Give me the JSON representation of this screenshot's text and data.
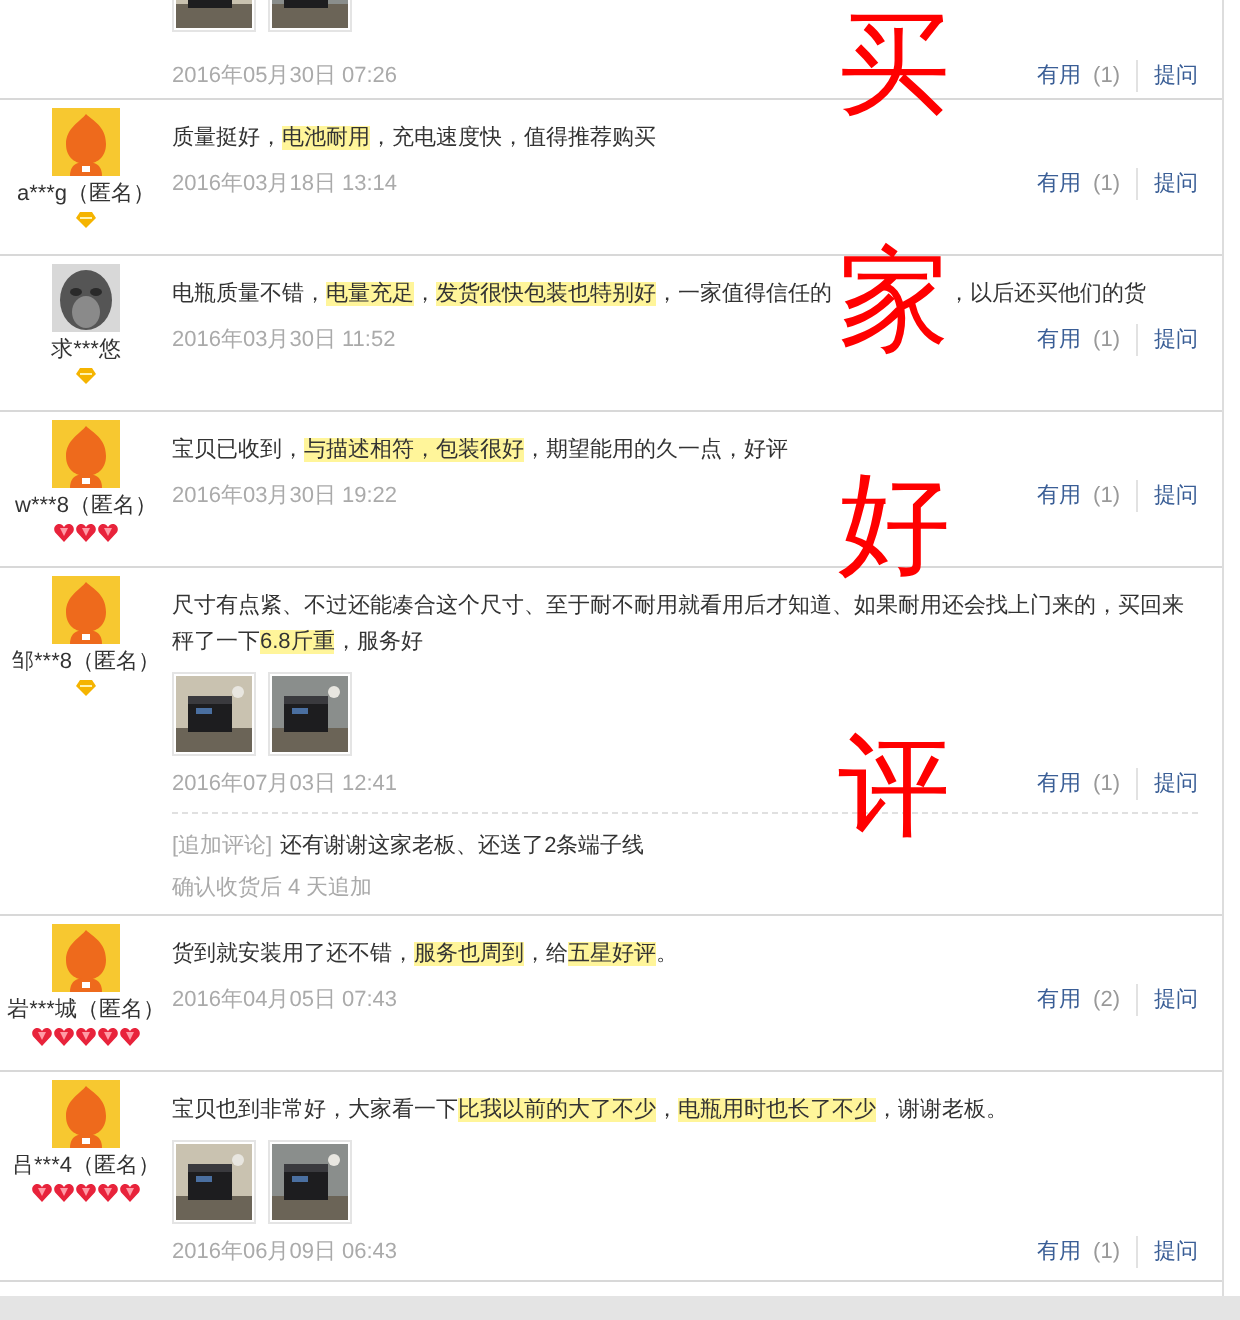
{
  "overlay": {
    "characters": [
      "买",
      "家",
      "好",
      "评"
    ]
  },
  "reviews": [
    {
      "date": "2016年05月30日 07:26",
      "useful_label": "有用",
      "useful_count": "(1)",
      "ask_label": "提问"
    },
    {
      "user": {
        "name": "a***g（匿名）",
        "avatar": {
          "kind": "mascot"
        },
        "rank": {
          "kind": "diamond"
        }
      },
      "text": "质量挺好，**电池耐用**，充电速度快，值得推荐购买",
      "date": "2016年03月18日 13:14",
      "useful_label": "有用",
      "useful_count": "(1)",
      "ask_label": "提问"
    },
    {
      "user": {
        "name": "求***悠",
        "rank": {
          "kind": "diamond"
        }
      },
      "text": "电瓶质量不错，**电量充足**，**发货很快包装也特别好**，一家值得信任的",
      "text_after_overlay": "，以后还买他们的货",
      "date": "2016年03月30日 11:52",
      "useful_label": "有用",
      "useful_count": "(1)",
      "ask_label": "提问"
    },
    {
      "user": {
        "name": "w***8（匿名）",
        "avatar": {
          "kind": "mascot"
        },
        "rank": {
          "kind": "heart",
          "stars": 3
        }
      },
      "text": "宝贝已收到，**与描述相符，包装很好**，期望能用的久一点，好评",
      "date": "2016年03月30日 19:22",
      "useful_label": "有用",
      "useful_count": "(1)",
      "ask_label": "提问"
    },
    {
      "user": {
        "name": "邹***8（匿名）",
        "avatar": {
          "kind": "mascot"
        },
        "rank": {
          "kind": "diamond"
        }
      },
      "text": "尺寸有点紧、不过还能凑合这个尺寸、至于耐不耐用就看用后才知道、如果耐用还会找上门来的，买回来秤了一下**6.8斤重**，服务好",
      "date": "2016年07月03日 12:41",
      "useful_label": "有用",
      "useful_count": "(1)",
      "ask_label": "提问",
      "followup": {
        "label": "[追加评论]",
        "text": "还有谢谢这家老板、还送了2条端子线",
        "note": "确认收货后 4 天追加"
      }
    },
    {
      "user": {
        "name": "岩***城（匿名）",
        "avatar": {
          "kind": "mascot"
        },
        "rank": {
          "kind": "heart",
          "stars": 5
        }
      },
      "text": "货到就安装用了还不错，**服务也周到**，给**五星好评**。",
      "date": "2016年04月05日 07:43",
      "useful_label": "有用",
      "useful_count": "(2)",
      "ask_label": "提问"
    },
    {
      "user": {
        "name": "吕***4（匿名）",
        "avatar": {
          "kind": "mascot"
        },
        "rank": {
          "kind": "heart",
          "stars": 5
        }
      },
      "text": "宝贝也到非常好，大家看一下**比我以前的大了不少**，**电瓶用时也长了不少**，谢谢老板。",
      "date": "2016年06月09日 06:43",
      "useful_label": "有用",
      "useful_count": "(1)",
      "ask_label": "提问"
    }
  ]
}
